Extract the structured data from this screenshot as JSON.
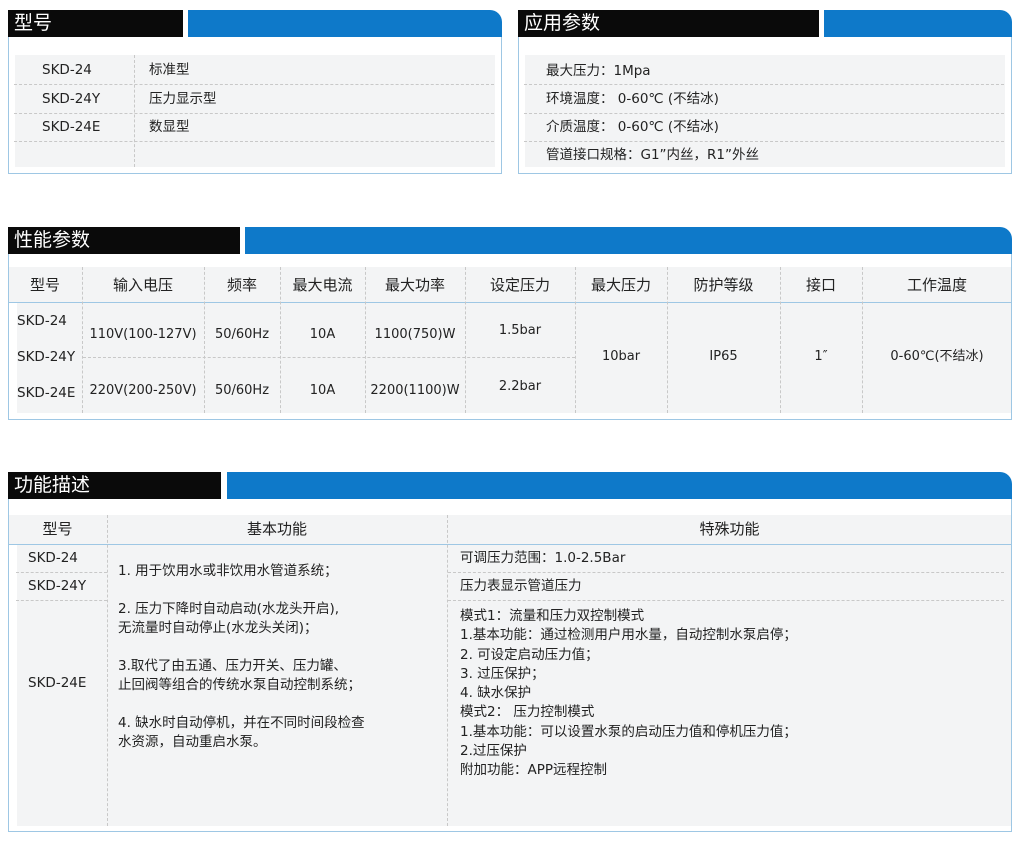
{
  "model_section": {
    "title": "型号",
    "rows": [
      {
        "model": "SKD-24",
        "type": "标准型"
      },
      {
        "model": "SKD-24Y",
        "type": "压力显示型"
      },
      {
        "model": "SKD-24E",
        "type": "数显型"
      }
    ]
  },
  "application_section": {
    "title": "应用参数",
    "items": [
      "最大压力：1Mpa",
      "环境温度： 0-60℃ (不结冰)",
      "介质温度： 0-60℃ (不结冰)",
      "管道接口规格：G1”内丝，R1”外丝"
    ]
  },
  "performance_section": {
    "title": "性能参数",
    "headers": [
      "型号",
      "输入电压",
      "频率",
      "最大电流",
      "最大功率",
      "设定压力",
      "最大压力",
      "防护等级",
      "接口",
      "工作温度"
    ],
    "models": [
      "SKD-24",
      "SKD-24Y",
      "SKD-24E"
    ],
    "row_a": {
      "voltage": "110V(100-127V)",
      "freq": "50/60Hz",
      "current": "10A",
      "power": "1100(750)W",
      "set_pressure": "1.5bar"
    },
    "row_b": {
      "voltage": "220V(200-250V)",
      "freq": "50/60Hz",
      "current": "10A",
      "power": "2200(1100)W",
      "set_pressure": "2.2bar"
    },
    "max_pressure": "10bar",
    "ip": "IP65",
    "port": "1″",
    "temp": "0-60℃(不结冰)"
  },
  "function_section": {
    "title": "功能描述",
    "headers": [
      "型号",
      "基本功能",
      "特殊功能"
    ],
    "models": [
      "SKD-24",
      "SKD-24Y",
      "SKD-24E"
    ],
    "basic": [
      "1. 用于饮用水或非饮用水管道系统；",
      "2. 压力下降时自动启动(水龙头开启),\n无流量时自动停止(水龙头关闭)；",
      "3.取代了由五通、压力开关、压力罐、\n止回阀等组合的传统水泵自动控制系统；",
      "4. 缺水时自动停机，并在不同时间段检查\n水资源，自动重启水泵。"
    ],
    "special_24": "可调压力范围：1.0-2.5Bar",
    "special_24y": "压力表显示管道压力",
    "special_24e": "模式1：流量和压力双控制模式\n1.基本功能：通过检测用户用水量，自动控制水泵启停；\n2. 可设定启动压力值；\n3. 过压保护；\n4. 缺水保护\n模式2： 压力控制模式\n1.基本功能：可以设置水泵的启动压力值和停机压力值；\n2.过压保护\n附加功能：APP远程控制"
  }
}
